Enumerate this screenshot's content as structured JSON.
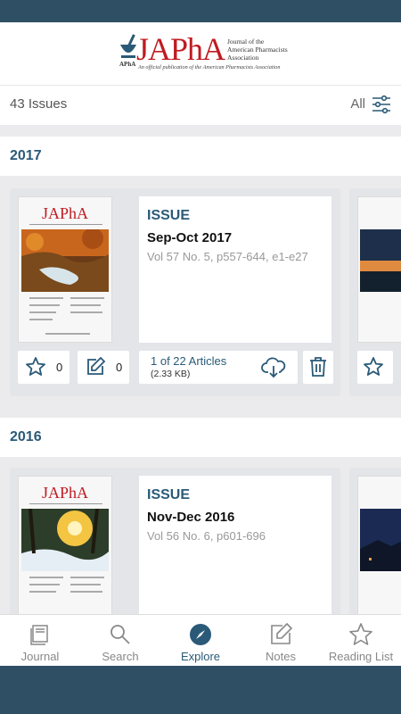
{
  "header": {
    "logo_text": "JAPhA",
    "logo_mark_label": "APhA",
    "logo_desc": "Journal of the American Pharmacists Association",
    "logo_tagline": "An official publication of the American Pharmacists Association"
  },
  "filter": {
    "count_label": "43 Issues",
    "filter_label": "All",
    "icon": "filter-sliders-icon"
  },
  "colors": {
    "accent": "#2a5a77",
    "brand_red": "#c01b22",
    "status_bar": "#2e4f64"
  },
  "sections": [
    {
      "year": "2017",
      "issue": {
        "type": "ISSUE",
        "date": "Sep-Oct 2017",
        "volume": "Vol 57 No. 5, p557-644, e1-e27",
        "cover_masthead": "JAPhA",
        "favorites": "0",
        "notes": "0",
        "articles": "1 of 22 Articles",
        "size": "(2.33 KB)"
      }
    },
    {
      "year": "2016",
      "issue": {
        "type": "ISSUE",
        "date": "Nov-Dec 2016",
        "volume": "Vol 56 No. 6, p601-696",
        "cover_masthead": "JAPhA"
      }
    }
  ],
  "tabs": [
    {
      "label": "Journal",
      "icon": "book-icon",
      "active": false
    },
    {
      "label": "Search",
      "icon": "search-icon",
      "active": false
    },
    {
      "label": "Explore",
      "icon": "compass-icon",
      "active": true
    },
    {
      "label": "Notes",
      "icon": "note-edit-icon",
      "active": false
    },
    {
      "label": "Reading List",
      "icon": "star-icon",
      "active": false
    }
  ]
}
